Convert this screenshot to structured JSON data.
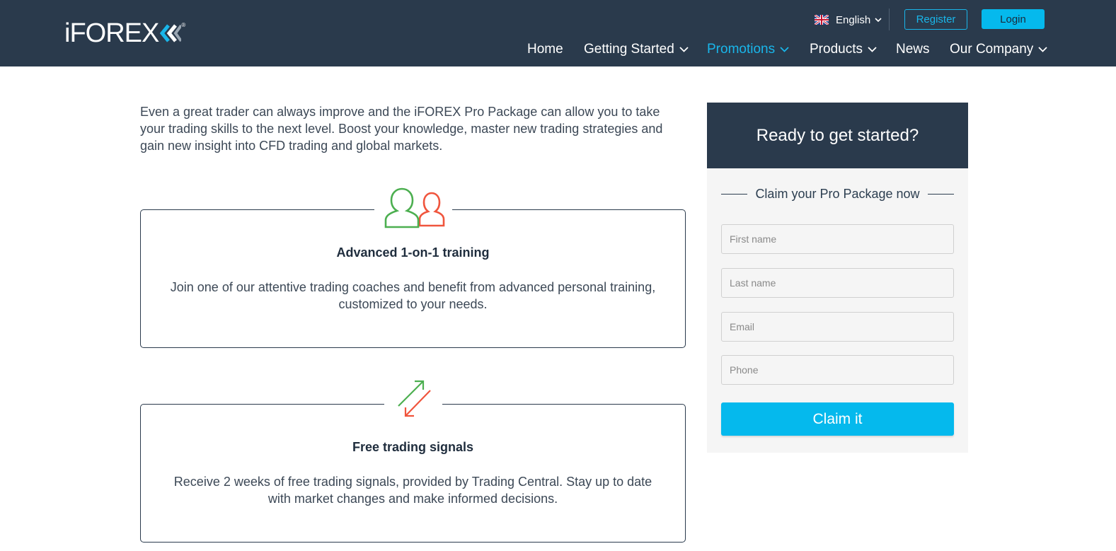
{
  "header": {
    "logo_text": "iFOREX",
    "logo_reg": "®",
    "language": "English",
    "register_label": "Register",
    "login_label": "Login",
    "nav": [
      {
        "label": "Home",
        "has_dropdown": false,
        "active": false
      },
      {
        "label": "Getting Started",
        "has_dropdown": true,
        "active": false
      },
      {
        "label": "Promotions",
        "has_dropdown": true,
        "active": true
      },
      {
        "label": "Products",
        "has_dropdown": true,
        "active": false
      },
      {
        "label": "News",
        "has_dropdown": false,
        "active": false
      },
      {
        "label": "Our Company",
        "has_dropdown": true,
        "active": false
      }
    ]
  },
  "main": {
    "intro": "Even a great trader can always improve and the iFOREX Pro Package can allow you to take your trading skills to the next level. Boost your knowledge, master new trading strategies and gain new insight into CFD trading and global markets.",
    "features": [
      {
        "icon": "users-icon",
        "title": "Advanced 1-on-1 training",
        "description": "Join one of our attentive trading coaches and benefit from advanced personal training, customized to your needs."
      },
      {
        "icon": "exchange-arrows-icon",
        "title": "Free trading signals",
        "description": "Receive 2 weeks of free trading signals, provided by Trading Central. Stay up to date with market changes and make informed decisions."
      }
    ]
  },
  "sidebar": {
    "heading": "Ready to get started?",
    "subheading": "Claim your Pro Package now",
    "fields": {
      "first_name": {
        "placeholder": "First name",
        "value": ""
      },
      "last_name": {
        "placeholder": "Last name",
        "value": ""
      },
      "email": {
        "placeholder": "Email",
        "value": ""
      },
      "phone": {
        "placeholder": "Phone",
        "value": ""
      }
    },
    "submit_label": "Claim it"
  },
  "colors": {
    "header_bg": "#2a3a4c",
    "accent": "#05b9ed",
    "nav_active": "#19b6ea",
    "icon_green": "#4caf50",
    "icon_red": "#f0553d"
  }
}
